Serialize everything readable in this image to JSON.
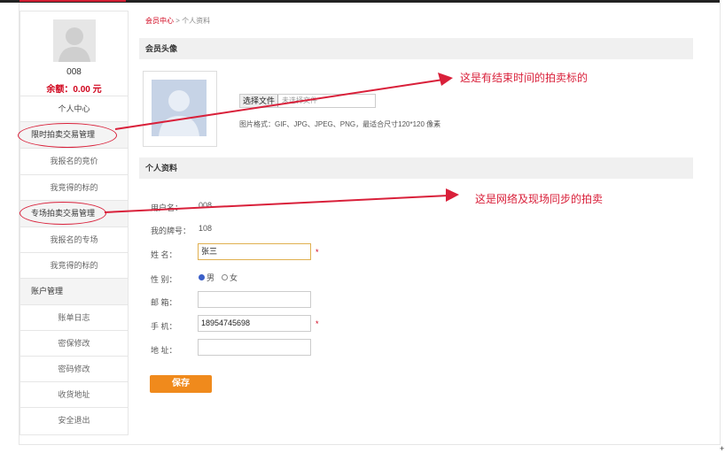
{
  "breadcrumb": {
    "home": "会员中心",
    "separator": ">",
    "current": "个人资料"
  },
  "sidebar": {
    "username": "008",
    "balance": "余额：0.00 元",
    "items": [
      {
        "label": "个人中心"
      },
      {
        "label": "限时拍卖交易管理"
      },
      {
        "label": "我报名的竞价"
      },
      {
        "label": "我竞得的标的"
      },
      {
        "label": "专场拍卖交易管理"
      },
      {
        "label": "我报名的专场"
      },
      {
        "label": "我竞得的标的"
      },
      {
        "label": "账户管理"
      },
      {
        "label": "账单日志"
      },
      {
        "label": "密保修改"
      },
      {
        "label": "密码修改"
      },
      {
        "label": "收货地址"
      },
      {
        "label": "安全退出"
      }
    ]
  },
  "avatar_section": {
    "title": "会员头像",
    "file_button": "选择文件",
    "file_status": "未选择文件",
    "hint": "图片格式：GIF、JPG、JPEG、PNG，最适合尺寸120*120 像素"
  },
  "profile": {
    "title": "个人资料",
    "user_id_label": "用户名：",
    "user_id_value": "008",
    "paddle_label": "我的牌号：",
    "paddle_value": "108",
    "name_label": "姓 名：",
    "name_value": "张三",
    "gender_label": "性 别：",
    "gender_male": "男",
    "gender_female": "女",
    "gender_selected": "男",
    "email_label": "邮 箱：",
    "email_value": "",
    "phone_label": "手 机：",
    "phone_value": "18954745698",
    "address_label": "地 址：",
    "address_value": "",
    "required_mark": "*",
    "save_label": "保存"
  },
  "annotations": {
    "top": "这是有结束时间的拍卖标的",
    "bottom": "这是网络及现场同步的拍卖"
  },
  "colors": {
    "accent": "#d9203a",
    "save": "#f08a1c",
    "link": "#d0021b"
  },
  "icons": {
    "avatar": "user-silhouette-icon",
    "cursor": "plus-cursor-icon"
  }
}
